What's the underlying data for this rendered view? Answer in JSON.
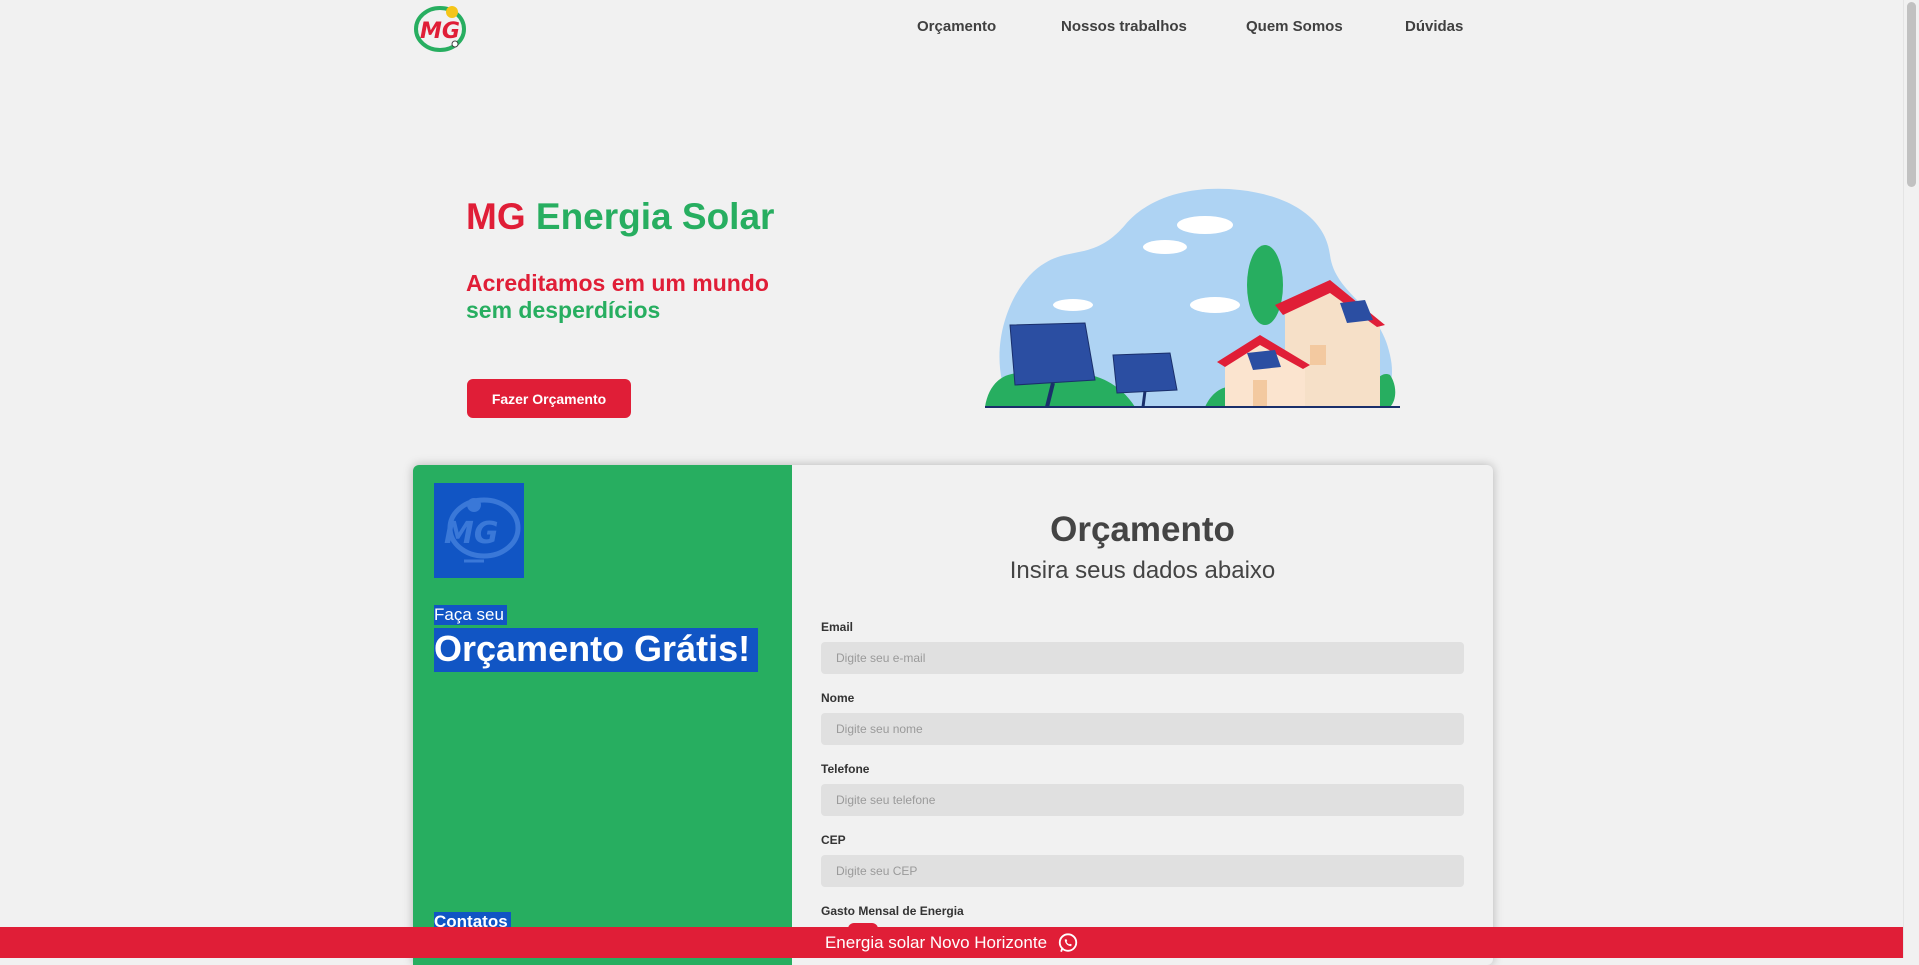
{
  "header": {
    "logo_text": "MG",
    "nav": [
      "Orçamento",
      "Nossos trabalhos",
      "Quem Somos",
      "Dúvidas"
    ]
  },
  "hero": {
    "title_red": "MG",
    "title_green": "Energia Solar",
    "subtitle_red": "Acreditamos em um mundo",
    "subtitle_green": "sem desperdícios",
    "cta_label": "Fazer Orçamento"
  },
  "quote_panel": {
    "badge_text": "MG",
    "small_text": "Faça seu",
    "big_text": "Orçamento Grátis!",
    "contacts_label": "Contatos"
  },
  "form": {
    "title": "Orçamento",
    "subtitle": "Insira seus dados abaixo",
    "fields": [
      {
        "label": "Email",
        "placeholder": "Digite seu e-mail",
        "value": ""
      },
      {
        "label": "Nome",
        "placeholder": "Digite seu nome",
        "value": ""
      },
      {
        "label": "Telefone",
        "placeholder": "Digite seu telefone",
        "value": ""
      },
      {
        "label": "CEP",
        "placeholder": "Digite seu CEP",
        "value": ""
      },
      {
        "label": "Gasto Mensal de Energia"
      }
    ]
  },
  "bottom_bar": {
    "text": "Energia solar Novo Horizonte",
    "icon": "whatsapp-icon"
  },
  "colors": {
    "brand_red": "#e01e37",
    "brand_green": "#27ae60",
    "selection_blue": "#1155c4",
    "background": "#f1f1f1"
  }
}
